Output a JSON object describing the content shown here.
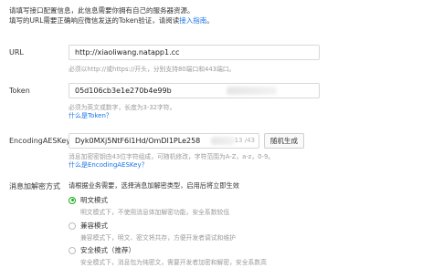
{
  "intro": {
    "line1": "请填写接口配置信息，此信息需要你拥有自己的服务器资源。",
    "line2_prefix": "填写的URL需要正确响应微信发送的Token验证，请阅读",
    "line2_link": "接入指南",
    "line2_suffix": "。"
  },
  "url": {
    "label": "URL",
    "value": "http://xiaoliwang.natapp1.cc",
    "hint": "必须以http://或https://开头，分别支持80端口和443端口。"
  },
  "token": {
    "label": "Token",
    "value": "05d106cb3e1e270b4e99b",
    "hint": "必须为英文或数字，长度为3-32字符。",
    "link": "什么是Token？"
  },
  "aeskey": {
    "label": "EncodingAESKey",
    "value": "Dyk0MXj5NtF6l1Hd/OmDI1PLe258",
    "counter": "13 /43",
    "button": "随机生成",
    "hint": "消息加密密钥由43位字符组成，可随机修改，字符范围为A-Z，a-z，0-9。",
    "link": "什么是EncodingAESKey？"
  },
  "encryption": {
    "label": "消息加解密方式",
    "desc": "请根据业务需要，选择消息加解密类型，启用后将立即生效",
    "options": [
      {
        "label": "明文模式",
        "desc": "明文模式下，不使用消息体加解密功能，安全系数较低",
        "checked": true
      },
      {
        "label": "兼容模式",
        "desc": "兼容模式下，明文、密文将共存，方便开发者调试和维护",
        "checked": false
      },
      {
        "label": "安全模式（推荐）",
        "desc": "安全模式下，消息包为纯密文，需要开发者加密和解密，安全系数高",
        "checked": false
      }
    ]
  }
}
